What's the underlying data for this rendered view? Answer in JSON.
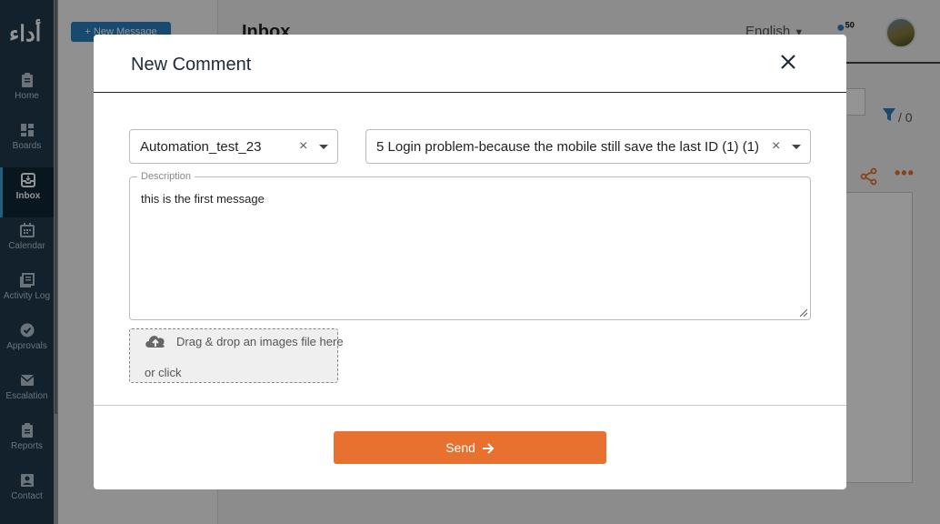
{
  "app": {
    "logo": "أداء",
    "new_message_label": "+ New Message",
    "page_title": "Inbox",
    "language": "English",
    "notification_count": "50",
    "filter_count": "/ 0"
  },
  "sidebar": {
    "items": [
      {
        "label": "Home",
        "icon": "clipboard-icon"
      },
      {
        "label": "Boards",
        "icon": "boards-icon"
      },
      {
        "label": "Inbox",
        "icon": "inbox-icon",
        "active": true
      },
      {
        "label": "Calendar",
        "icon": "calendar-icon"
      },
      {
        "label": "Activity Log",
        "icon": "activity-log-icon"
      },
      {
        "label": "Approvals",
        "icon": "check-circle-icon"
      },
      {
        "label": "Escalation",
        "icon": "mail-icon"
      },
      {
        "label": "Reports",
        "icon": "report-icon"
      },
      {
        "label": "Contact",
        "icon": "contact-icon"
      }
    ]
  },
  "modal": {
    "title": "New Comment",
    "project_select": {
      "value": "Automation_test_23"
    },
    "task_select": {
      "value": "5 Login problem-because the mobile still save the last ID (1) (1)"
    },
    "description": {
      "legend": "Description",
      "value": "this is the first message"
    },
    "dropzone": {
      "text": "Drag & drop an images file here",
      "or_click": "or click"
    },
    "send_label": "Send"
  },
  "colors": {
    "accent": "#e8712f",
    "sidebar": "#1f3a4d",
    "primary": "#2a7fc0"
  }
}
